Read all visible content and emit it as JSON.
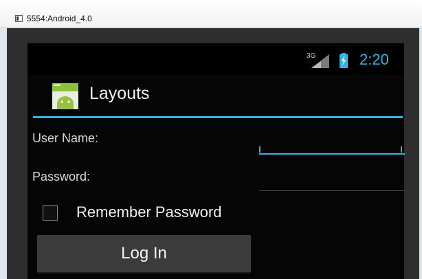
{
  "window": {
    "title": "5554:Android_4.0"
  },
  "status_bar": {
    "network": "3G",
    "time": "2:20"
  },
  "action_bar": {
    "title": "Layouts",
    "icon": "android-app-icon"
  },
  "form": {
    "username_label": "User Name:",
    "username_value": "",
    "password_label": "Password:",
    "password_value": "",
    "remember_label": "Remember Password",
    "remember_checked": false,
    "login_label": "Log In"
  },
  "colors": {
    "accent": "#33b5e5",
    "screen_background": "#050505",
    "button_background": "#3b3b3b",
    "text": "#f0f0f0"
  },
  "icons": {
    "window": "emulator-window-icon",
    "signal": "signal-3g-icon",
    "battery": "battery-charging-icon",
    "checkbox": "checkbox-icon"
  }
}
